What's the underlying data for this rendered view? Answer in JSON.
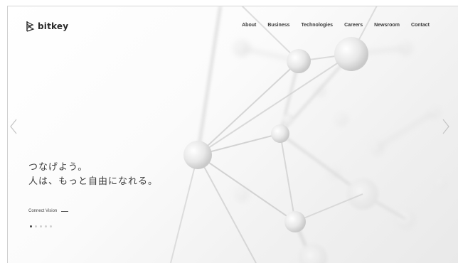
{
  "brand": {
    "name": "bitkey"
  },
  "nav": {
    "items": [
      {
        "label": "About"
      },
      {
        "label": "Business"
      },
      {
        "label": "Technologies"
      },
      {
        "label": "Careers"
      },
      {
        "label": "Newsroom"
      },
      {
        "label": "Contact"
      }
    ]
  },
  "hero": {
    "line1": "つなげよう。",
    "line2": "人は、もっと自由になれる。"
  },
  "cta": {
    "label": "Connect Vision"
  },
  "carousel": {
    "slide_count": 5,
    "active_slide": 1,
    "prev_icon": "chevron-left-icon",
    "next_icon": "chevron-right-icon"
  },
  "colors": {
    "text": "#333333",
    "nav_text": "#3a3a3a",
    "background": "#f4f4f4",
    "dot_active": "#444444",
    "dot_inactive": "#cfcfcf"
  }
}
